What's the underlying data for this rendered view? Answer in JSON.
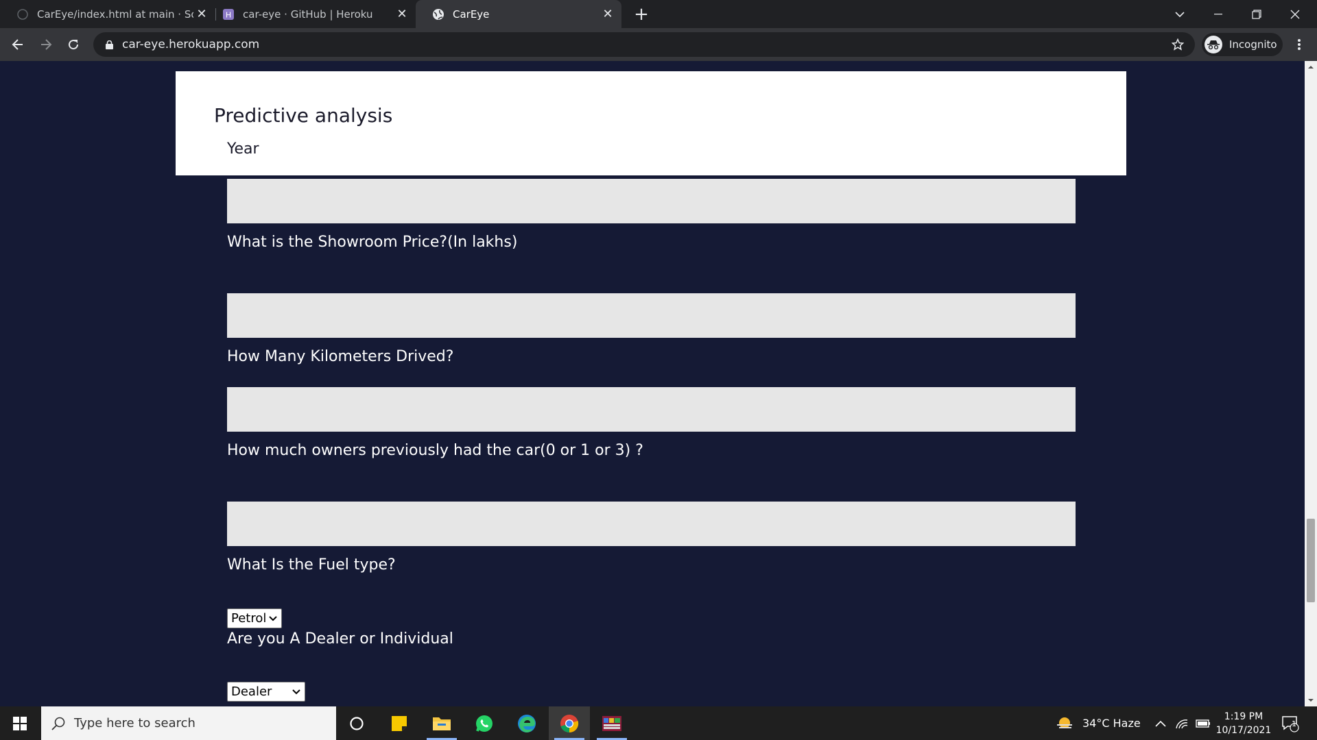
{
  "browser": {
    "tabs": [
      {
        "title": "CarEye/index.html at main · Soun",
        "active": false
      },
      {
        "title": "car-eye · GitHub | Heroku",
        "active": false
      },
      {
        "title": "CarEye",
        "active": true
      }
    ],
    "url": "car-eye.herokuapp.com",
    "profile_label": "Incognito"
  },
  "page": {
    "heading": "Predictive analysis",
    "year_label": "Year",
    "questions": {
      "showroom_price": "What is the Showroom Price?(In lakhs)",
      "kms_driven": "How Many Kilometers Drived?",
      "owners": "How much owners previously had the car(0 or 1 or 3) ?",
      "fuel_type": "What Is the Fuel type?",
      "seller_type": "Are you A Dealer or Individual"
    },
    "fuel_select": {
      "selected": "Petrol"
    },
    "seller_select": {
      "selected": "Dealer"
    }
  },
  "taskbar": {
    "search_placeholder": "Type here to search",
    "weather": "34°C  Haze",
    "time": "1:19 PM",
    "date": "10/17/2021",
    "notification_count": "1",
    "pinned_icons": [
      "cortana-icon",
      "sticky-notes-icon",
      "file-explorer-icon",
      "whatsapp-icon",
      "edge-icon",
      "chrome-icon",
      "winrar-icon"
    ]
  },
  "colors": {
    "page_bg": "#151a35",
    "input_bg": "#e6e6e6",
    "header_card_bg": "#ffffff",
    "label_text": "#ffffff"
  }
}
